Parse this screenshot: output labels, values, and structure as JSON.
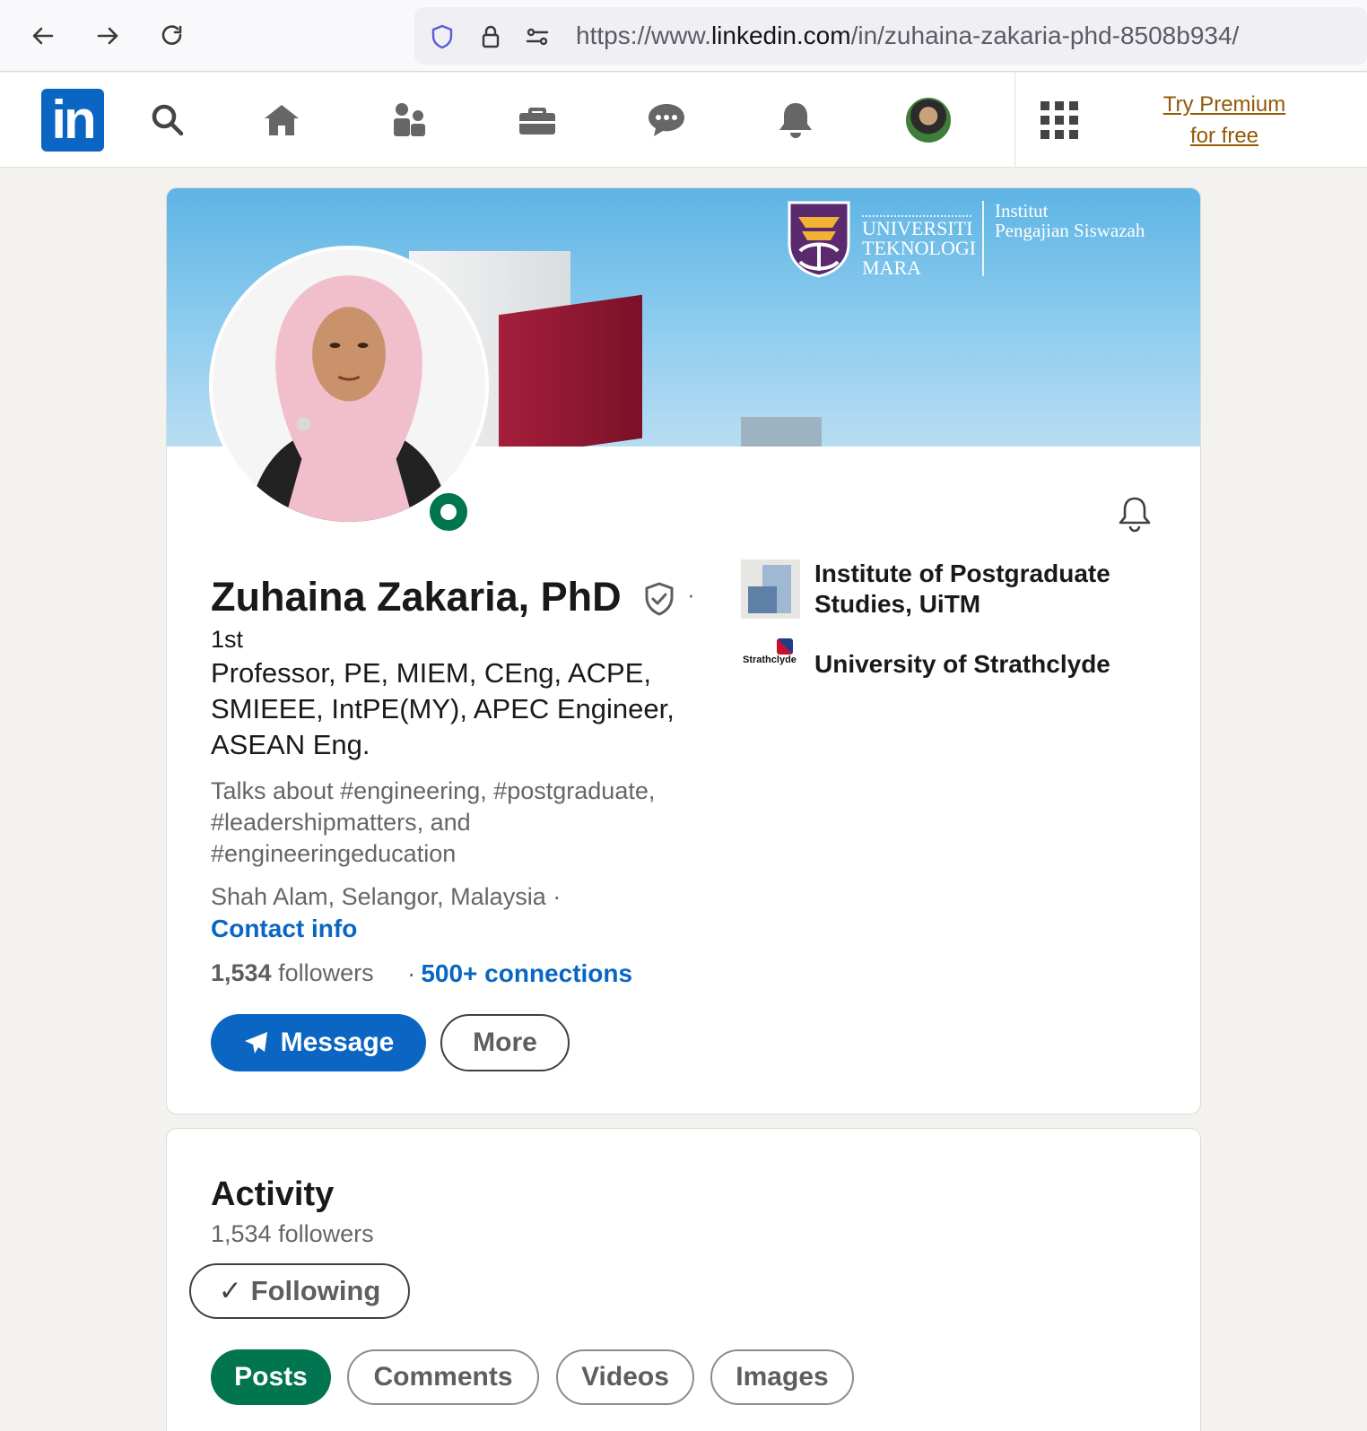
{
  "browser": {
    "url_prefix": "https://www.",
    "url_host": "linkedin.com",
    "url_path": "/in/zuhaina-zakaria-phd-8508b934/"
  },
  "topnav": {
    "logo": "in",
    "premium_line1": "Try Premium",
    "premium_line2": "for free",
    "icons": [
      "search-icon",
      "home-icon",
      "my-network-icon",
      "jobs-icon",
      "messaging-icon",
      "notifications-icon",
      "apps-grid-icon"
    ]
  },
  "banner": {
    "uitm_line1": "UNIVERSITI",
    "uitm_line2": "TEKNOLOGI",
    "uitm_line3": "MARA",
    "ips_line1": "Institut",
    "ips_line2": "Pengajian Siswazah"
  },
  "profile": {
    "name": "Zuhaina Zakaria, PhD",
    "separator": "·",
    "degree": "1st",
    "headline": "Professor, PE, MIEM, CEng, ACPE, SMIEEE, IntPE(MY), APEC Engineer, ASEAN Eng.",
    "talks_about": "Talks about #engineering, #postgraduate, #leadershipmatters, and #engineeringeducation",
    "location": "Shah Alam, Selangor, Malaysia ·",
    "contact_info": "Contact info",
    "followers_count": "1,534",
    "followers_label": "followers",
    "connections_sep": "·",
    "connections": "500+ connections",
    "message_button": "Message",
    "more_button": "More",
    "orgs": [
      {
        "name": "Institute of Postgraduate Studies, UiTM"
      },
      {
        "name": "University of Strathclyde"
      }
    ],
    "strathclyde_logo_text": "Strathclyde"
  },
  "activity": {
    "title": "Activity",
    "followers": "1,534 followers",
    "following_check": "✓",
    "following_button": "Following",
    "tabs": [
      "Posts",
      "Comments",
      "Videos",
      "Images"
    ],
    "active_tab": "Posts"
  },
  "colors": {
    "linkedin_blue": "#0a66c2",
    "active_green": "#01754f",
    "premium_gold": "#915907"
  }
}
